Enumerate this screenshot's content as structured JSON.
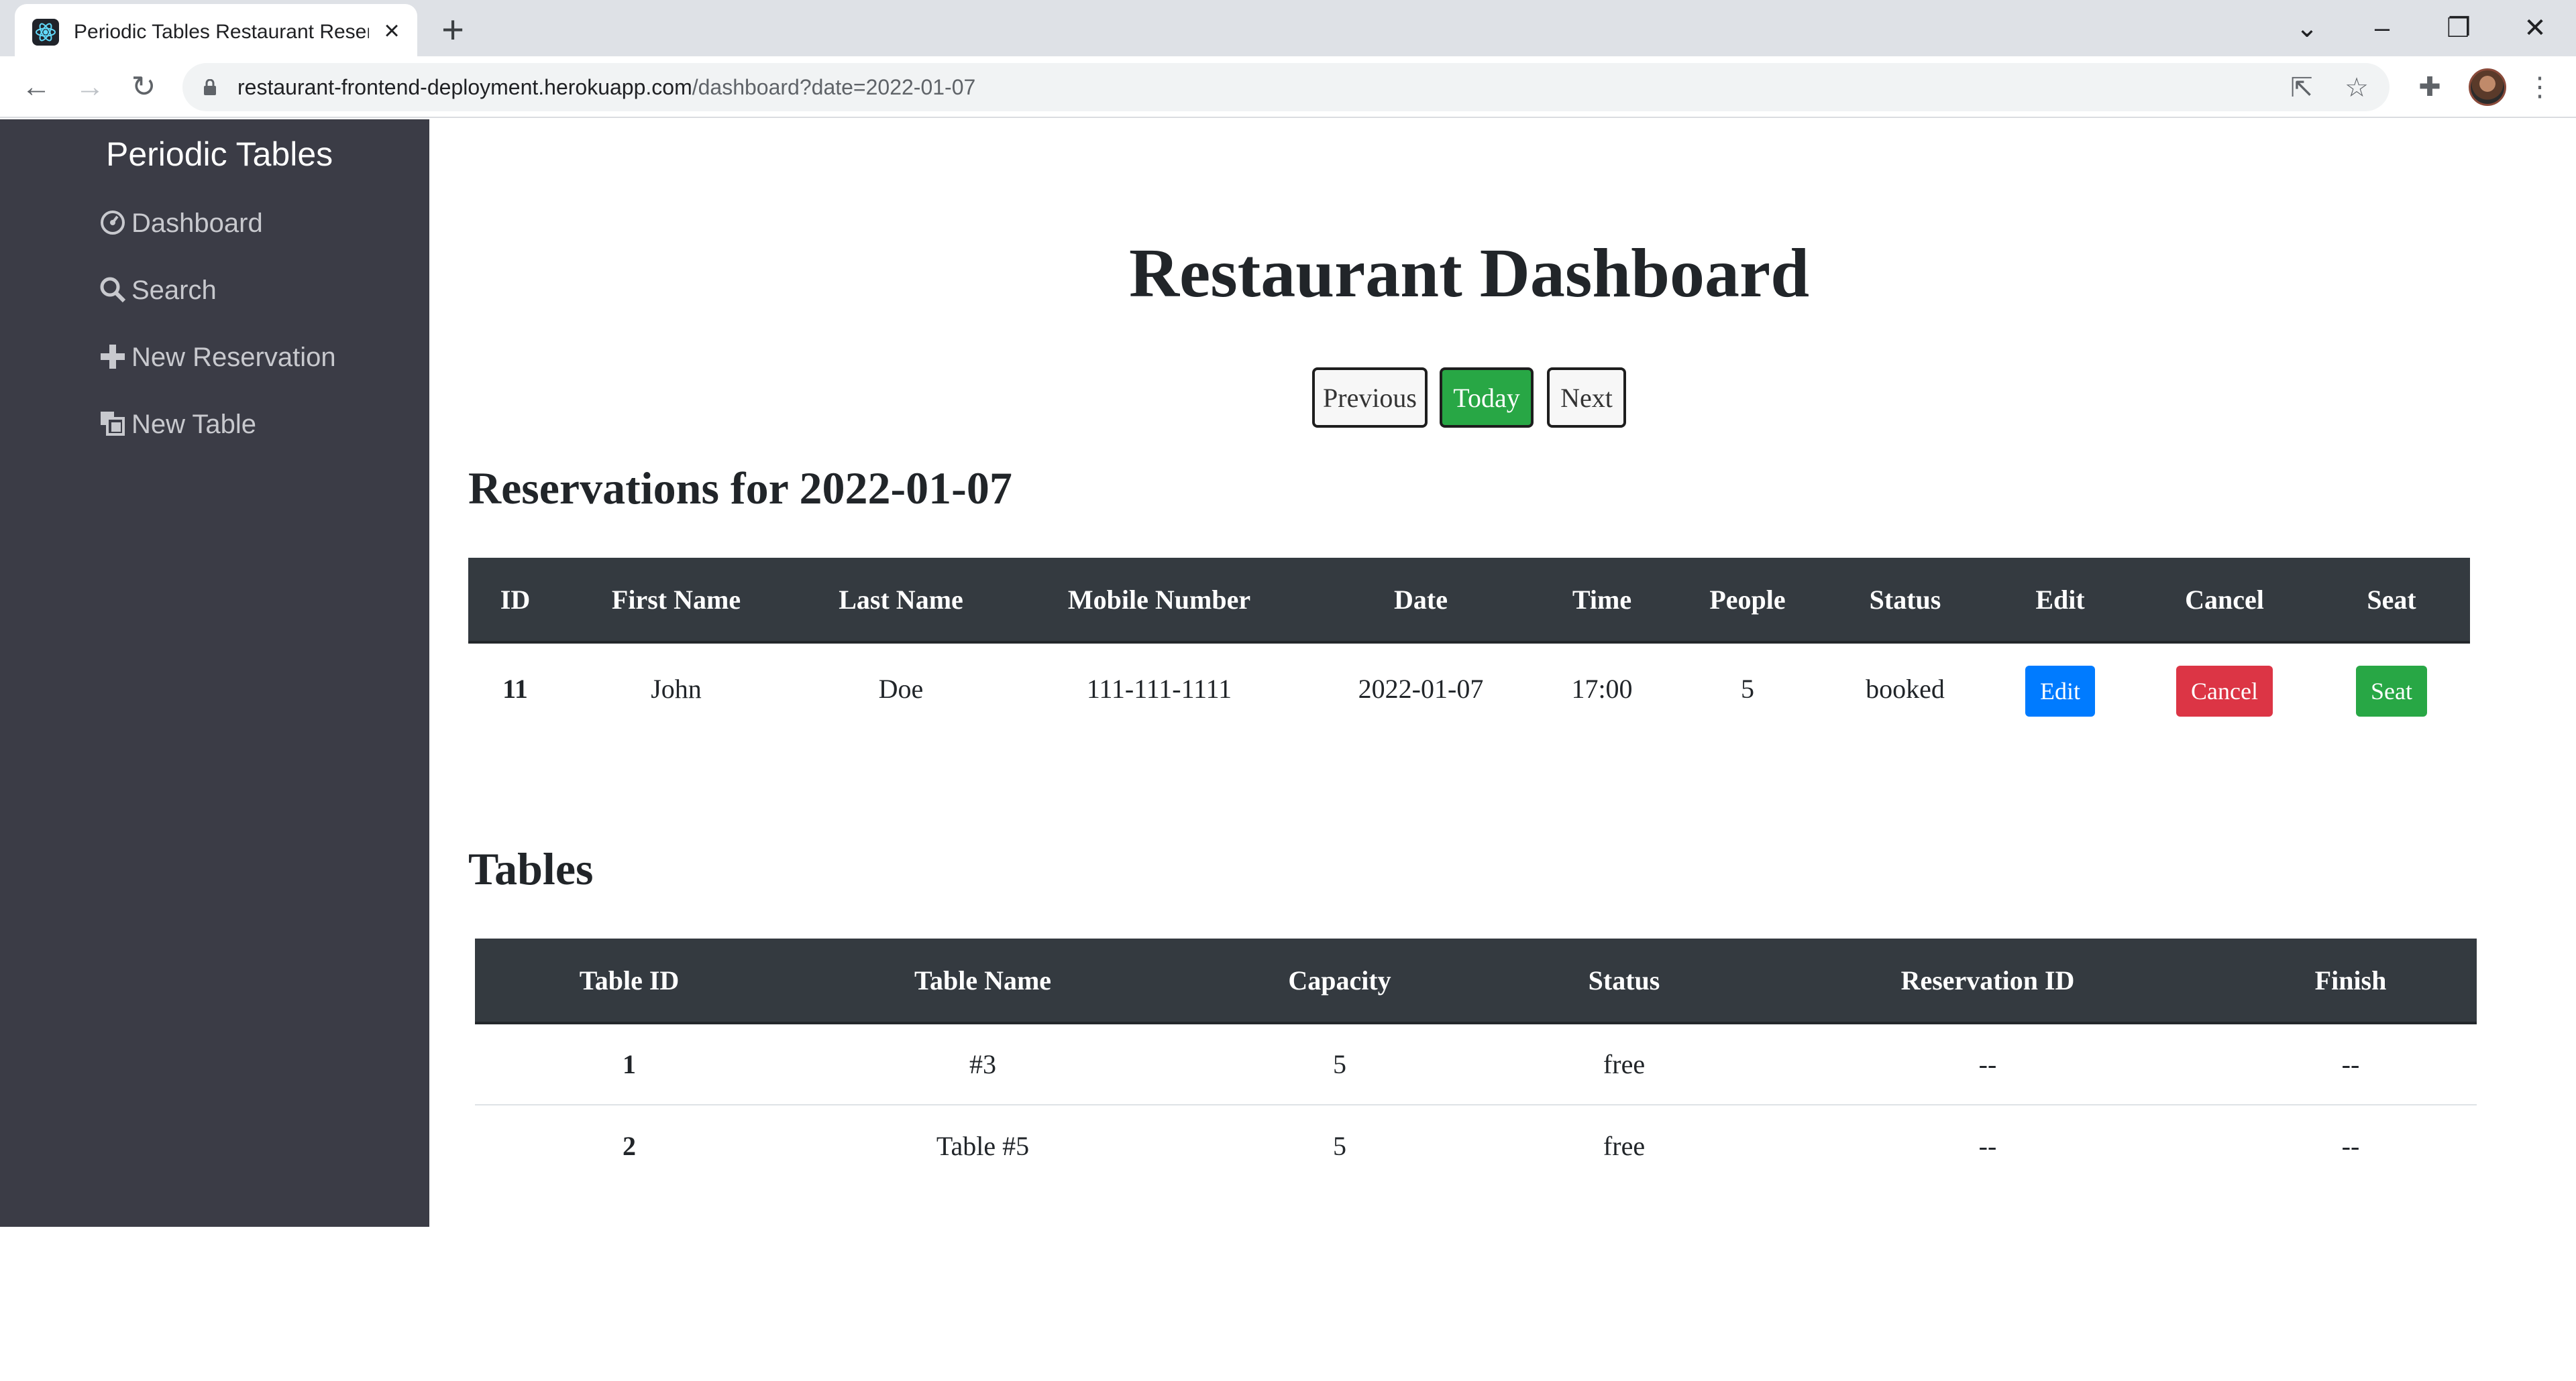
{
  "browser": {
    "tab_title": "Periodic Tables Restaurant Reserv",
    "url_host": "restaurant-frontend-deployment.herokuapp.com",
    "url_path": "/dashboard?date=2022-01-07"
  },
  "icons": {
    "back": "arrow-left",
    "forward": "arrow-right",
    "reload": "reload",
    "lock": "lock",
    "share": "share",
    "star": "star",
    "extensions": "puzzle",
    "menu": "kebab"
  },
  "sidebar": {
    "brand": "Periodic Tables",
    "items": [
      {
        "label": "Dashboard",
        "icon": "dashboard-gauge"
      },
      {
        "label": "Search",
        "icon": "search"
      },
      {
        "label": "New Reservation",
        "icon": "plus"
      },
      {
        "label": "New Table",
        "icon": "layers"
      }
    ]
  },
  "main": {
    "title": "Restaurant Dashboard",
    "nav": {
      "previous": "Previous",
      "today": "Today",
      "next": "Next"
    },
    "reservations_heading": "Reservations for 2022-01-07",
    "reservations": {
      "headers": [
        "ID",
        "First Name",
        "Last Name",
        "Mobile Number",
        "Date",
        "Time",
        "People",
        "Status",
        "Edit",
        "Cancel",
        "Seat"
      ],
      "rows": [
        {
          "id": "11",
          "first_name": "John",
          "last_name": "Doe",
          "mobile": "111-111-1111",
          "date": "2022-01-07",
          "time": "17:00",
          "people": "5",
          "status": "booked",
          "edit": "Edit",
          "cancel": "Cancel",
          "seat": "Seat"
        }
      ]
    },
    "tables_heading": "Tables",
    "tables": {
      "headers": [
        "Table ID",
        "Table Name",
        "Capacity",
        "Status",
        "Reservation ID",
        "Finish"
      ],
      "rows": [
        {
          "table_id": "1",
          "name": "#3",
          "capacity": "5",
          "status": "free",
          "reservation_id": "--",
          "finish": "--"
        },
        {
          "table_id": "2",
          "name": "Table #5",
          "capacity": "5",
          "status": "free",
          "reservation_id": "--",
          "finish": "--"
        }
      ]
    }
  },
  "colors": {
    "sidebar_bg": "#3b3c46",
    "table_header_bg": "#343a40",
    "primary": "#007bff",
    "danger": "#dc3545",
    "success": "#28a745"
  }
}
